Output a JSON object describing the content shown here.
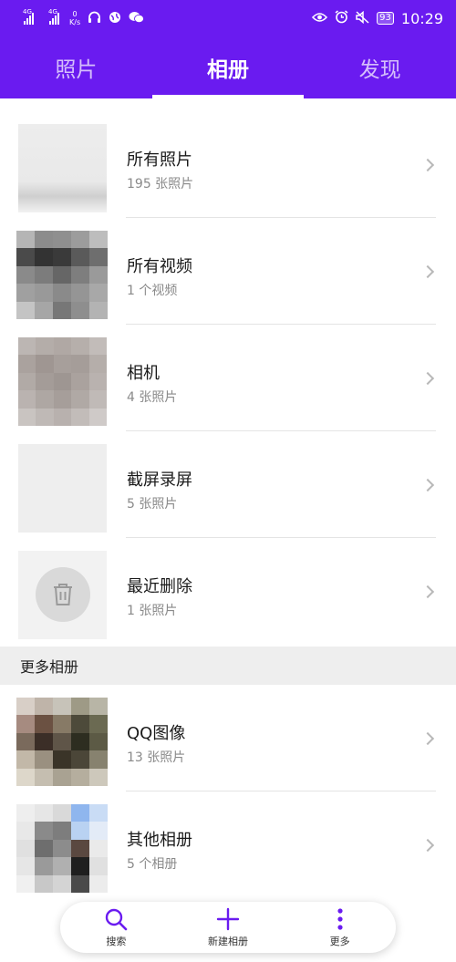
{
  "status_bar": {
    "signal1_tag": "4G",
    "signal2_tag": "4G",
    "net_speed_value": "0",
    "net_speed_unit": "K/s",
    "battery": "93",
    "time": "10:29",
    "icons": [
      "headset-icon",
      "globe-icon",
      "wechat-icon",
      "eye-icon",
      "alarm-icon",
      "mute-icon"
    ]
  },
  "tabs": [
    {
      "label": "照片",
      "active": false
    },
    {
      "label": "相册",
      "active": true
    },
    {
      "label": "发现",
      "active": false
    }
  ],
  "albums": [
    {
      "title": "所有照片",
      "count": "195 张照片"
    },
    {
      "title": "所有视频",
      "count": "1 个视频"
    },
    {
      "title": "相机",
      "count": "4 张照片"
    },
    {
      "title": "截屏录屏",
      "count": "5 张照片"
    },
    {
      "title": "最近删除",
      "count": "1 张照片"
    }
  ],
  "more_section": {
    "header": "更多相册",
    "albums": [
      {
        "title": "QQ图像",
        "count": "13 张照片"
      },
      {
        "title": "其他相册",
        "count": "5 个相册"
      }
    ]
  },
  "bottom_bar": {
    "accent": "#6a1bf0",
    "items": [
      {
        "label": "搜索",
        "icon": "search-icon"
      },
      {
        "label": "新建相册",
        "icon": "plus-icon"
      },
      {
        "label": "更多",
        "icon": "more-vertical-icon"
      }
    ]
  },
  "colors": {
    "primary": "#6a1bf0",
    "section_bg": "#eeeeee"
  }
}
